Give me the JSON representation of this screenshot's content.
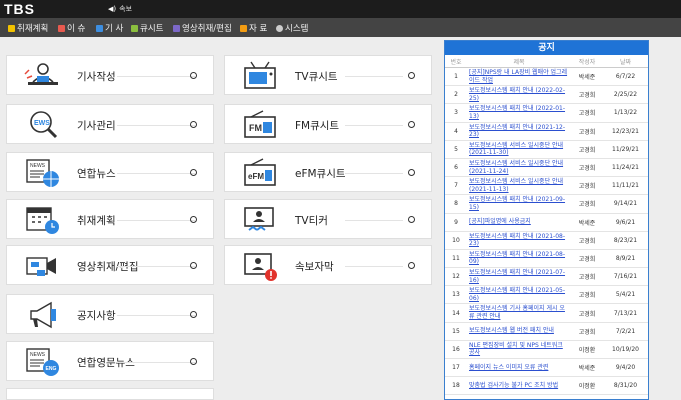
{
  "header": {
    "logo": "TBS",
    "breaking_label": "속보"
  },
  "nav": [
    {
      "label": "취재계획",
      "color": "#f2c200"
    },
    {
      "label": "이 슈",
      "color": "#e85a4f"
    },
    {
      "label": "기 사",
      "color": "#3d8ee0"
    },
    {
      "label": "큐시트",
      "color": "#8bbf3f"
    },
    {
      "label": "영상취재/편집",
      "color": "#7c68c8"
    },
    {
      "label": "자 료",
      "color": "#f39c12"
    },
    {
      "label": "시스템",
      "color": "#cccccc"
    }
  ],
  "menu": {
    "left": [
      "기사작성",
      "기사관리",
      "연합뉴스",
      "취재계획",
      "영상취재/편집",
      "공지사항",
      "연합영문뉴스"
    ],
    "right": [
      "TV큐시트",
      "FM큐시트",
      "eFM큐시트",
      "TV티커",
      "속보자막"
    ]
  },
  "notice": {
    "title": "공지",
    "columns": [
      "번호",
      "제목",
      "작성자",
      "날짜"
    ],
    "rows": [
      {
        "no": "1",
        "title": "[공지]NPS랑 내 LA장비 웹매야 업그레이드 작업",
        "author": "박세준",
        "date": "6/7/22"
      },
      {
        "no": "2",
        "title": "보도정보시스템 패치 안내 (2022-02-25)",
        "author": "고경희",
        "date": "2/25/22"
      },
      {
        "no": "3",
        "title": "보도정보시스템 패치 안내 (2022-01-13)",
        "author": "고경희",
        "date": "1/13/22"
      },
      {
        "no": "4",
        "title": "보도정보시스템 패치 안내 (2021-12-23)",
        "author": "고경희",
        "date": "12/23/21"
      },
      {
        "no": "5",
        "title": "보도정보시스템 서비스 일시중단 안내 (2021-11-30)",
        "author": "고경희",
        "date": "11/29/21"
      },
      {
        "no": "6",
        "title": "보도정보시스템 서비스 일시중단 안내 (2021-11-24)",
        "author": "고경희",
        "date": "11/24/21"
      },
      {
        "no": "7",
        "title": "보도정보시스템 서비스 일시중단 안내 (2021-11-13)",
        "author": "고경희",
        "date": "11/11/21"
      },
      {
        "no": "8",
        "title": "보도정보시스템 패치 안내 (2021-09-15)",
        "author": "고경희",
        "date": "9/14/21"
      },
      {
        "no": "9",
        "title": "[공지]파일명에 사용금지",
        "author": "박세준",
        "date": "9/6/21"
      },
      {
        "no": "10",
        "title": "보도정보시스템 패치 안내 (2021-08-23)",
        "author": "고경희",
        "date": "8/23/21"
      },
      {
        "no": "11",
        "title": "보도정보시스템 패치 안내 (2021-08-09)",
        "author": "고경희",
        "date": "8/9/21"
      },
      {
        "no": "12",
        "title": "보도정보시스템 패치 안내 (2021-07-16)",
        "author": "고경희",
        "date": "7/16/21"
      },
      {
        "no": "13",
        "title": "보도정보시스템 패치 안내 (2021-05-06)",
        "author": "고경희",
        "date": "5/4/21"
      },
      {
        "no": "14",
        "title": "보도정보시스템 기사 홈페이지 게시 오류 관련 안내",
        "author": "고경희",
        "date": "7/13/21"
      },
      {
        "no": "15",
        "title": "보도정보시스템 웹 버전 패치 안내",
        "author": "고경희",
        "date": "7/2/21"
      },
      {
        "no": "16",
        "title": "NLE 편집장비 설치 및 NPS 네트워크 공사",
        "author": "이정환",
        "date": "10/19/20"
      },
      {
        "no": "17",
        "title": "홈페이지 뉴스 이미지 오류 관련",
        "author": "박세준",
        "date": "9/4/20"
      },
      {
        "no": "18",
        "title": "맞춤법 검사기능 불가 PC 조치 방법",
        "author": "이정환",
        "date": "8/31/20"
      }
    ]
  }
}
